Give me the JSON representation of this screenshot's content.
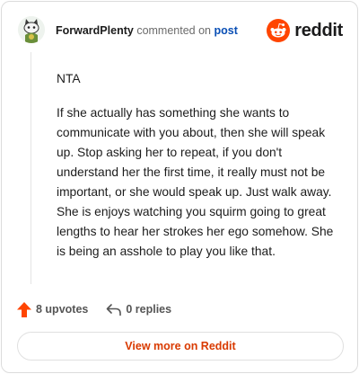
{
  "header": {
    "author": "ForwardPlenty",
    "action_text": "commented on",
    "post_link": "post",
    "brand_name": "reddit",
    "avatar_icon": "snoo-avatar-icon",
    "brand_icon": "reddit-logo-icon"
  },
  "comment": {
    "paragraphs": [
      "NTA",
      "If she actually has something she wants to communicate with you about, then she will speak up. Stop asking her to repeat, if you don't understand her the first time, it really must not be important, or she would speak up. Just walk away. She is enjoys watching you squirm going to great lengths to hear her strokes her ego somehow. She is being an asshole to play you like that."
    ]
  },
  "actions": {
    "upvotes_label": "8 upvotes",
    "replies_label": "0 replies",
    "upvote_icon": "upvote-arrow-icon",
    "reply_icon": "reply-arrow-icon"
  },
  "footer": {
    "view_more_label": "View more on Reddit"
  },
  "colors": {
    "brand_orange": "#ff4500",
    "link_blue": "#0a4fb5",
    "button_text": "#d93a00"
  }
}
